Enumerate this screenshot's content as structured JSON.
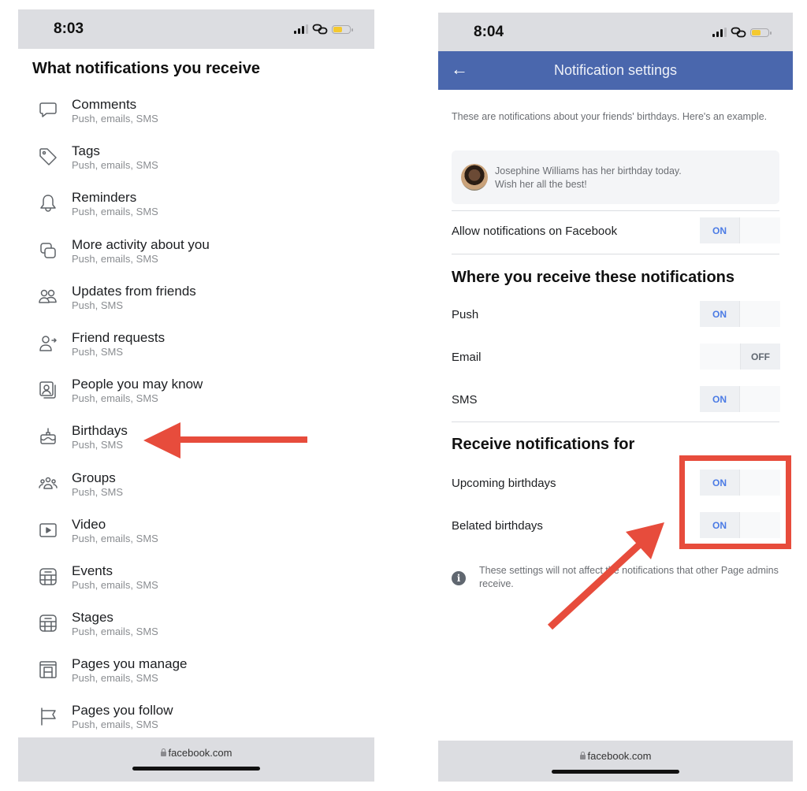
{
  "left_screen": {
    "status_bar": {
      "time": "8:03"
    },
    "section_title": "What notifications you receive",
    "items": [
      {
        "icon": "comment-icon",
        "name": "Comments",
        "channels": "Push, emails, SMS"
      },
      {
        "icon": "tag-icon",
        "name": "Tags",
        "channels": "Push, emails, SMS"
      },
      {
        "icon": "bell-icon",
        "name": "Reminders",
        "channels": "Push, emails, SMS"
      },
      {
        "icon": "activity-icon",
        "name": "More activity about you",
        "channels": "Push, emails, SMS"
      },
      {
        "icon": "friends-icon",
        "name": "Updates from friends",
        "channels": "Push, SMS"
      },
      {
        "icon": "friend-request-icon",
        "name": "Friend requests",
        "channels": "Push, SMS"
      },
      {
        "icon": "people-icon",
        "name": "People you may know",
        "channels": "Push, emails, SMS"
      },
      {
        "icon": "cake-icon",
        "name": "Birthdays",
        "channels": "Push, SMS"
      },
      {
        "icon": "groups-icon",
        "name": "Groups",
        "channels": "Push, SMS"
      },
      {
        "icon": "video-icon",
        "name": "Video",
        "channels": "Push, emails, SMS"
      },
      {
        "icon": "calendar-icon",
        "name": "Events",
        "channels": "Push, emails, SMS"
      },
      {
        "icon": "calendar-icon",
        "name": "Stages",
        "channels": "Push, emails, SMS"
      },
      {
        "icon": "page-icon",
        "name": "Pages you manage",
        "channels": "Push, emails, SMS"
      },
      {
        "icon": "flag-icon",
        "name": "Pages you follow",
        "channels": "Push, emails, SMS"
      }
    ],
    "bottom_bar": {
      "url": "facebook.com"
    }
  },
  "right_screen": {
    "status_bar": {
      "time": "8:04"
    },
    "header": {
      "back_icon": "←",
      "title": "Notification settings"
    },
    "intro": "These are notifications about your friends' birthdays. Here's an example.",
    "example": {
      "line1": "Josephine Williams has her birthday today.",
      "line2": "Wish her all the best!"
    },
    "allow": {
      "label": "Allow notifications on Facebook",
      "state": "ON"
    },
    "where_title": "Where you receive these notifications",
    "channels": [
      {
        "label": "Push",
        "state": "ON"
      },
      {
        "label": "Email",
        "state": "OFF"
      },
      {
        "label": "SMS",
        "state": "ON"
      }
    ],
    "receive_title": "Receive notifications for",
    "receive": [
      {
        "label": "Upcoming birthdays",
        "state": "ON"
      },
      {
        "label": "Belated birthdays",
        "state": "ON"
      }
    ],
    "info_icon": "i",
    "note": "These settings will not affect the notifications that other Page admins receive.",
    "bottom_bar": {
      "url": "facebook.com"
    }
  },
  "toggle_labels": {
    "on": "ON",
    "off": "OFF"
  },
  "colors": {
    "header_blue": "#4a67ad",
    "toggle_on_text": "#4b7be5",
    "annotation_red": "#e74c3c",
    "battery_yellow": "#f4c92f"
  }
}
